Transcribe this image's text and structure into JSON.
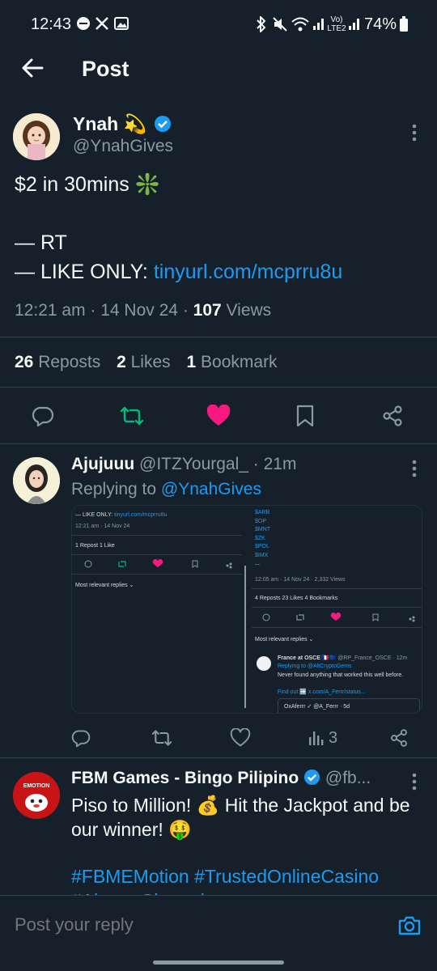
{
  "status_bar": {
    "time": "12:43",
    "battery": "74%",
    "network": "Vo) LTE2",
    "icons": [
      "dnd-icon",
      "x-icon",
      "gallery-icon",
      "bluetooth-icon",
      "mute-icon",
      "wifi-icon",
      "signal-icon",
      "battery-icon"
    ]
  },
  "header": {
    "title": "Post"
  },
  "post": {
    "author_name": "Ynah 💫",
    "handle": "@YnahGives",
    "text_line1": "$2 in 30mins ❇️",
    "text_line2": "— RT",
    "text_line3_prefix": "— LIKE ONLY: ",
    "text_link": "tinyurl.com/mcprru8u",
    "time": "12:21 am",
    "date": "14 Nov 24",
    "views_count": "107",
    "views_label": "Views",
    "reposts_count": "26",
    "reposts_label": "Reposts",
    "likes_count": "2",
    "likes_label": "Likes",
    "bookmarks_count": "1",
    "bookmarks_label": "Bookmark"
  },
  "reply1": {
    "name": "Ajujuuu",
    "handle": "@ITZYourgal_",
    "age": "· 21m",
    "replying_prefix": "Replying to ",
    "replying_to": "@YnahGives",
    "views": "3",
    "media": {
      "left_line": "— LIKE ONLY: ",
      "left_link": "tinyurl.com/mcprru8u",
      "left_meta": "12:21 am · 14 Nov 24",
      "left_stats": "1 Repost   1 Like",
      "left_sort": "Most relevant replies ⌄",
      "right_tickers": [
        "$ARB",
        "$OP",
        "$MNT",
        "$ZK",
        "$POL",
        "$IMX",
        "..."
      ],
      "right_meta": "12:05 am · 14 Nov 24 · 2,332 Views",
      "right_stats": "4 Reposts   23 Likes   4 Bookmarks",
      "right_sort": "Most relevant replies ⌄",
      "right_reply_name": "France at OSCE 🇫🇷🇪🇺",
      "right_reply_handle": "@RP_France_OSCE · 12m",
      "right_reply_to": "Replying to @AltCryptoGems",
      "right_reply_text": "Never found anything that worked this well before.",
      "right_reply_link": "Find out ➡️ x.com/A_Ferrr/status...",
      "right_quote": "OxAferrr ✓ @A_Ferrr · 5d"
    }
  },
  "reply2": {
    "name": "FBM Games - Bingo Pilipino",
    "handle": "@fb...",
    "line1": "Piso to Million! 💰 Hit the Jackpot and be our winner! 🤑",
    "tags": "#FBMEMotion #TrustedOnlineCasino #AlwaysChampion",
    "avatar_text": "EMOTION"
  },
  "composer": {
    "placeholder": "Post your reply"
  },
  "colors": {
    "background": "#15202b",
    "text": "#f7f9f9",
    "muted": "#8b98a5",
    "accent": "#1d9bf0",
    "repost_green": "#00ba7c",
    "like_pink": "#f91880"
  }
}
